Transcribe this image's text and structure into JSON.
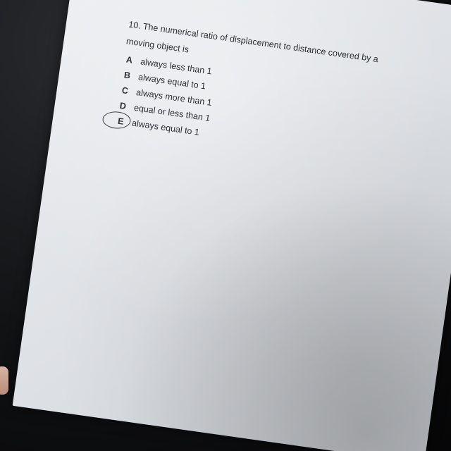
{
  "question": {
    "line_1": "10. The numerical ratio of displacement to distance covered by a",
    "line_2": "moving object is"
  },
  "options": [
    {
      "letter": "A",
      "text": "always less than 1"
    },
    {
      "letter": "B",
      "text": "always equal to 1"
    },
    {
      "letter": "C",
      "text": "always more than 1"
    },
    {
      "letter": "D",
      "text": "equal or less than 1"
    },
    {
      "letter": "E",
      "text": "always equal to 1"
    }
  ],
  "selected_option": "E"
}
